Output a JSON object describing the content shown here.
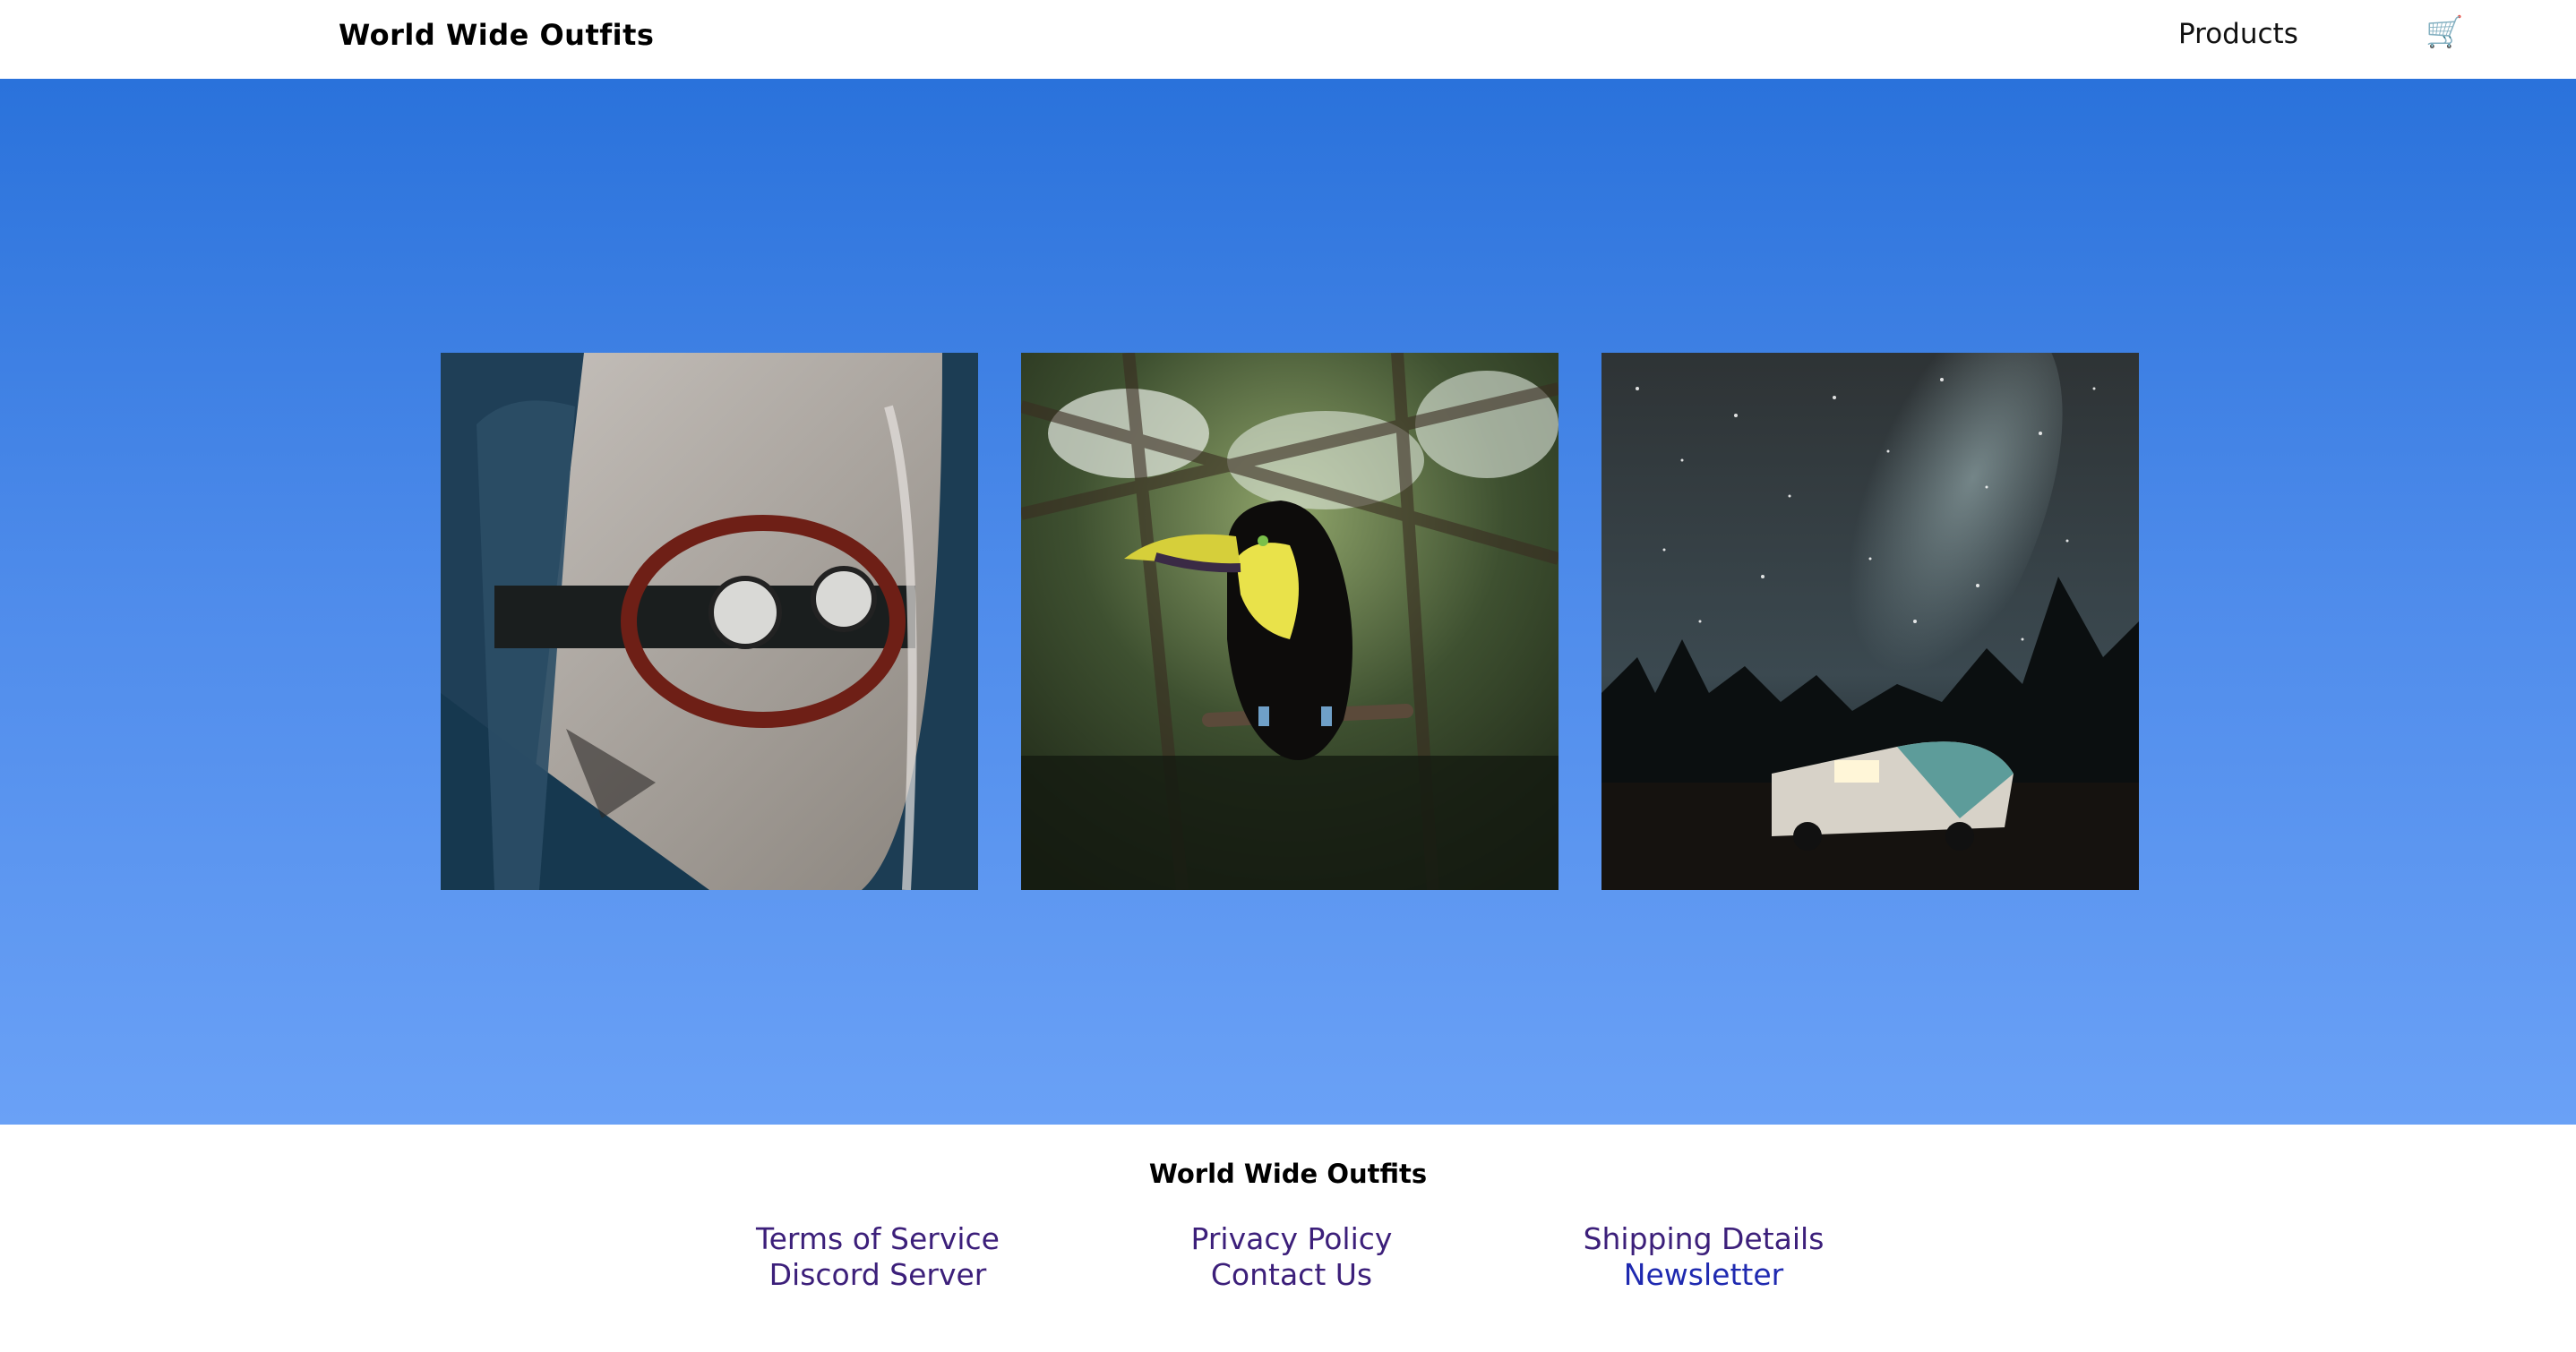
{
  "header": {
    "brand": "World Wide Outfits",
    "nav_products": "Products",
    "cart_icon": "🛒"
  },
  "gallery": {
    "images": [
      {
        "name": "car-photo",
        "description_icon": "vintage-car-interior"
      },
      {
        "name": "toucan-photo",
        "description_icon": "toucan-bird"
      },
      {
        "name": "night-sky-photo",
        "description_icon": "camper-under-milky-way"
      }
    ]
  },
  "footer": {
    "brand": "World Wide Outfits",
    "links": {
      "col1": [
        "Terms of Service",
        "Discord Server"
      ],
      "col2": [
        "Privacy Policy",
        "Contact Us"
      ],
      "col3": [
        "Shipping Details",
        "Newsletter"
      ]
    }
  },
  "colors": {
    "hero_top": "#2a72db",
    "hero_bottom": "#6aa1f6",
    "link_visited": "#3c1f7a",
    "link": "#1f2ab0"
  }
}
